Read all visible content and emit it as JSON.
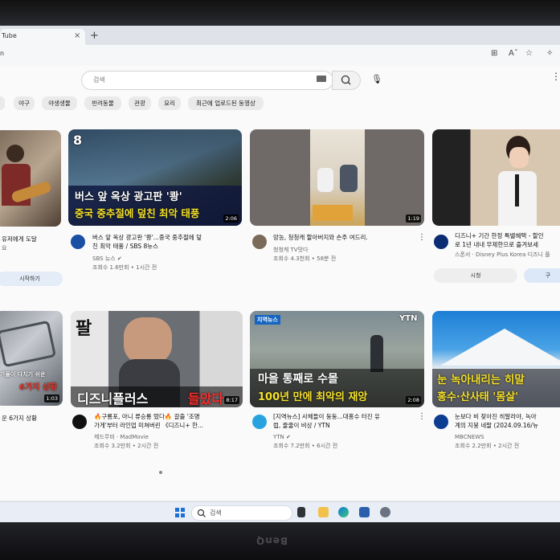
{
  "browser": {
    "tab_title": "Tube",
    "tab_close": "×",
    "new_tab": "+",
    "address_text": "n"
  },
  "youtube": {
    "search_placeholder": "검색",
    "chips": [
      "야구",
      "야생생물",
      "반려동물",
      "관광",
      "요리",
      "최근에 업로드된 동영상"
    ],
    "row1": [
      {
        "title": "유저에게 도달",
        "subtitle": "요",
        "button": "시작하기"
      },
      {
        "title": "버스 앞 옥상 광고판 '쾅'...중국 중추절에 덮",
        "title2": "친 최악 태풍 / SBS 8뉴스",
        "channel": "SBS 뉴스 ✔",
        "meta": "조회수 1.6만회 • 1시간 전",
        "duration": "2:06",
        "cap1": "버스 앞 옥상 광고판 '쾅'",
        "cap2": "중국 중추절에 덮친 최악 태풍",
        "logo": "8"
      },
      {
        "title": "앙농, 청청캐 할아버지와 손주 여드리.",
        "channel": "청청캐 TV맛다",
        "meta": "조회수 4.3천회 • 58분 전",
        "duration": "1:19"
      },
      {
        "title": "디즈니+ 기간 한정 특별혜택 - 할인",
        "title2": "로 1년 내내 무제한으로 즐겨보세",
        "channel": "스폰서 · Disney Plus Korea 디즈니 플",
        "button": "시청",
        "button2": "구"
      }
    ],
    "row2": [
      {
        "title": "운 6가지 상황",
        "cap": "6가지 상황",
        "duration": "1:03",
        "cap_small": "가들이 다치기 쉬운"
      },
      {
        "title": "🔥구룡포, 아니 류승룡 떴다🔥 갈출 '조명",
        "title2": "가게'부터 라인업 미쳐버린 《디즈니+ 한...",
        "channel": "제드무비 · MadMovie",
        "meta": "조회수 3.2만회 • 2시간 전",
        "duration": "8:17",
        "cap1": "디즈니플러스",
        "cap2": "들았다",
        "vert": "팔"
      },
      {
        "title": "[지역뉴스] 사체들이 둥둥...대홍수 터진 유",
        "title2": "럽, 줄줄이 비상 / YTN",
        "channel": "YTN ✔",
        "meta": "조회수 7.2만회 • 6시간 전",
        "duration": "2:08",
        "cap1": "마을 통째로 수몰",
        "cap2": "100년 만에 최악의 재앙",
        "badge": "지역뉴스",
        "ytn": "YTN"
      },
      {
        "title": "눈보다 비 잦아진 히말라야, 녹아",
        "title2": "계의 지붕 네팔 (2024.09.16/뉴",
        "channel": "MBCNEWS",
        "meta": "조회수 2.2만회 • 2시간 전",
        "cap1": "눈 녹아내리는 히말",
        "cap2": "홍수·산사태 '몸살'"
      }
    ]
  },
  "taskbar": {
    "search_text": "검색"
  },
  "monitor": {
    "brand": "BenQ"
  },
  "colors": {
    "accent": "#1f6fd8",
    "youtube_bg": "#fafafa",
    "caption_yellow": "#f5e12a",
    "caption_red": "#e8392b"
  }
}
